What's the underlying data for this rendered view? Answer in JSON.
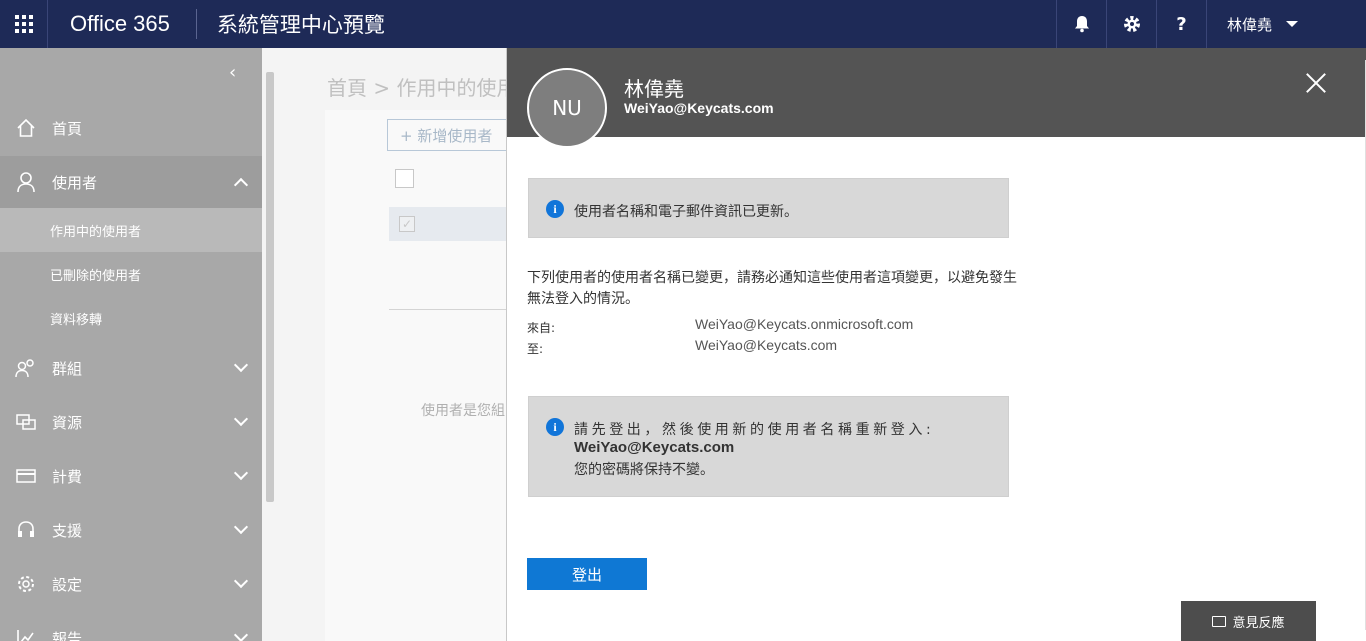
{
  "header": {
    "brand": "Office 365",
    "app_title": "系統管理中心預覽",
    "user_name": "林偉堯",
    "icons": [
      "bell-icon",
      "gear-icon",
      "help-icon"
    ],
    "help_label": "?"
  },
  "sidebar": {
    "collapse_glyph": "‹",
    "items": [
      {
        "label": "首頁",
        "icon": "home-icon"
      },
      {
        "label": "使用者",
        "icon": "user-icon"
      },
      {
        "label": "群組",
        "icon": "group-icon"
      },
      {
        "label": "資源",
        "icon": "resource-icon"
      },
      {
        "label": "計費",
        "icon": "billing-icon"
      },
      {
        "label": "支援",
        "icon": "headset-icon"
      },
      {
        "label": "設定",
        "icon": "settings-icon"
      },
      {
        "label": "報告",
        "icon": "report-icon"
      }
    ],
    "sub_items": [
      {
        "label": "作用中的使用者"
      },
      {
        "label": "已刪除的使用者"
      },
      {
        "label": "資料移轉"
      }
    ]
  },
  "background": {
    "breadcrumb": "首頁 > 作用中的使用",
    "add_user": "+ 新增使用者",
    "hint": "使用者是您組"
  },
  "panel": {
    "avatar_initials": "NU",
    "name": "林偉堯",
    "email": "WeiYao@Keycats.com",
    "notice1": "使用者名稱和電子郵件資訊已更新。",
    "description": "下列使用者的使用者名稱已變更，請務必通知這些使用者這項變更，以避免發生無法登入的情況。",
    "from_label": "來自:",
    "from_value": "WeiYao@Keycats.onmicrosoft.com",
    "to_label": "至:",
    "to_value": "WeiYao@Keycats.com",
    "notice2_line1": "請先登出，然後使用新的使用者名稱重新登入:",
    "notice2_line2": "WeiYao@Keycats.com",
    "notice2_line3": "您的密碼將保持不變。",
    "signout_label": "登出"
  },
  "feedback": {
    "label": "意見反應"
  }
}
